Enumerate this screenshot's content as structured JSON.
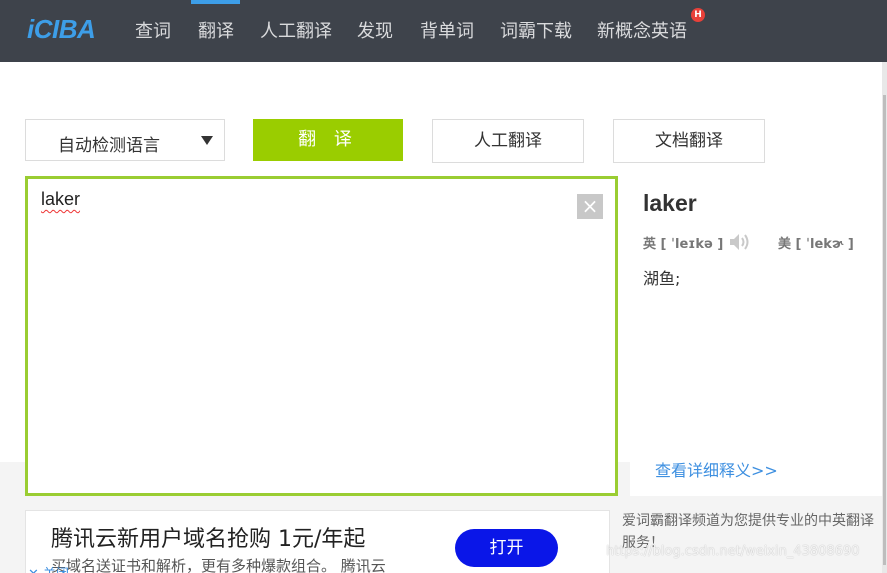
{
  "brand": {
    "logo": "iCIBA",
    "accent": "#3d9ee8"
  },
  "nav": {
    "items": [
      {
        "label": "查词"
      },
      {
        "label": "翻译"
      },
      {
        "label": "人工翻译"
      },
      {
        "label": "发现"
      },
      {
        "label": "背单词"
      },
      {
        "label": "词霸下载"
      },
      {
        "label": "新概念英语"
      }
    ],
    "active": "翻译",
    "hot_badge": "H"
  },
  "toolbar": {
    "language_select": "自动检测语言",
    "translate_button": "翻 译",
    "human_translate_button": "人工翻译",
    "doc_translate_button": "文档翻译"
  },
  "input": {
    "value": "laker",
    "clear_icon": "close-icon"
  },
  "result": {
    "word": "laker",
    "uk_label": "英",
    "uk_phonetic": "[ ˈleɪkə ]",
    "us_label": "美",
    "us_phonetic": "[ ˈlekɚ ]",
    "definition": "湖鱼;",
    "details_link": "查看详细释义>>"
  },
  "ad": {
    "title": "腾讯云新用户域名抢购 1元/年起",
    "subtitle": "买域名送证书和解析，更有多种爆款组合。 腾讯云",
    "button": "打开",
    "close_label": "关闭"
  },
  "side": {
    "description": "爱词霸翻译频道为您提供专业的中英翻译服务！"
  },
  "watermark": "https://blog.csdn.net/weixin_43808690",
  "colors": {
    "nav_bg": "#3e434b",
    "green": "#9acd00",
    "ad_button": "#0a16e8"
  }
}
